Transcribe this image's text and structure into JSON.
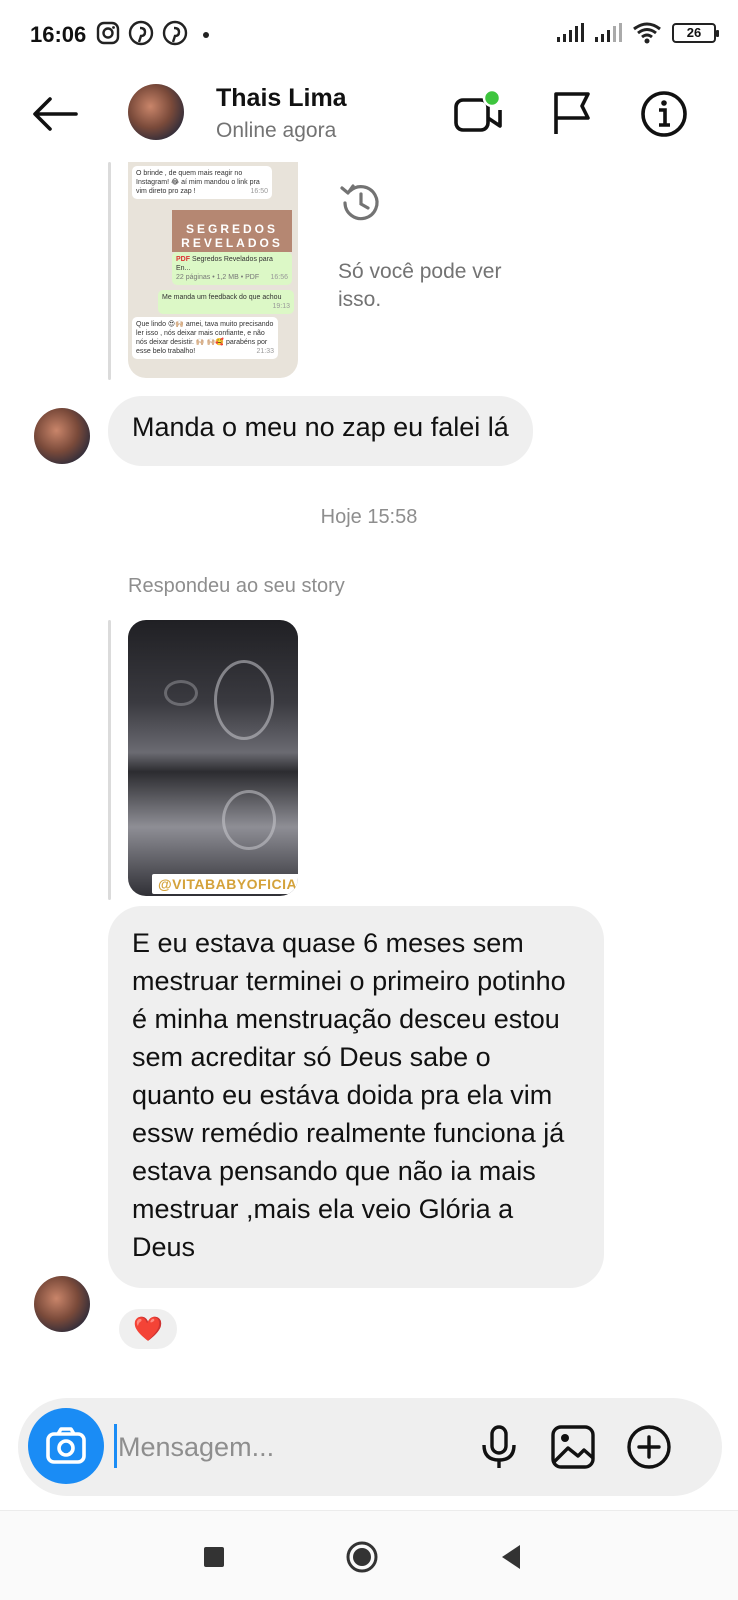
{
  "status_bar": {
    "time": "16:06",
    "battery": "26",
    "left_icons": [
      "instagram-icon",
      "pinterest-icon",
      "pinterest-icon",
      "dot-icon"
    ],
    "right_icons": [
      "signal-icon",
      "signal-icon",
      "wifi-icon",
      "battery-icon"
    ]
  },
  "header": {
    "name": "Thais Lima",
    "status": "Online agora",
    "online_color": "#3ec53e",
    "icons": [
      "back-arrow-icon",
      "video-call-icon",
      "flag-icon",
      "info-icon"
    ]
  },
  "chat": {
    "shared_screenshot": {
      "bubble1": "O brinde , de quem mais reagir no Instagram! 😂 aí mim mandou o link pra vim direto pro zap !",
      "bubble1_time": "16:50",
      "banner": "SEGREDOS REVELADOS",
      "pdf_name": "Segredos Revelados para En...",
      "pdf_meta": "22 páginas • 1,2 MB • PDF",
      "pdf_time": "16:56",
      "bubble2": "Me manda um feedback do que achou",
      "bubble2_time": "19:13",
      "bubble3": "Que lindo 😍🙌🏼 amei, tava muito precisando ler isso , nós deixar mais confiante, e não nós deixar desistir. 🙌🏼 🙌🏼🥰 parabéns por esse belo trabalho!",
      "bubble3_time": "21:33"
    },
    "only_you_text": "Só você pode ver isso.",
    "message1": "Manda o meu no zap eu falei lá",
    "day_separator": "Hoje 15:58",
    "replied_label": "Respondeu ao seu story",
    "story_tag": "@VITABABYOFICIAL",
    "message2": "E eu estava quase 6 meses sem mestruar terminei o primeiro potinho é minha menstruação desceu estou sem acreditar só Deus  sabe o quanto eu estáva doida pra ela  vim essw remédio realmente  funciona  já estava pensando que não ia mais mestruar ,mais ela veio Glória a Deus",
    "reaction": "❤️"
  },
  "composer": {
    "placeholder": "Mensagem...",
    "value": "",
    "accent_color": "#1a8cf5",
    "icons": [
      "camera-icon",
      "microphone-icon",
      "gallery-icon",
      "plus-circle-icon"
    ]
  },
  "nav_bar": {
    "icons": [
      "recents-square-icon",
      "home-circle-icon",
      "back-triangle-icon"
    ]
  }
}
